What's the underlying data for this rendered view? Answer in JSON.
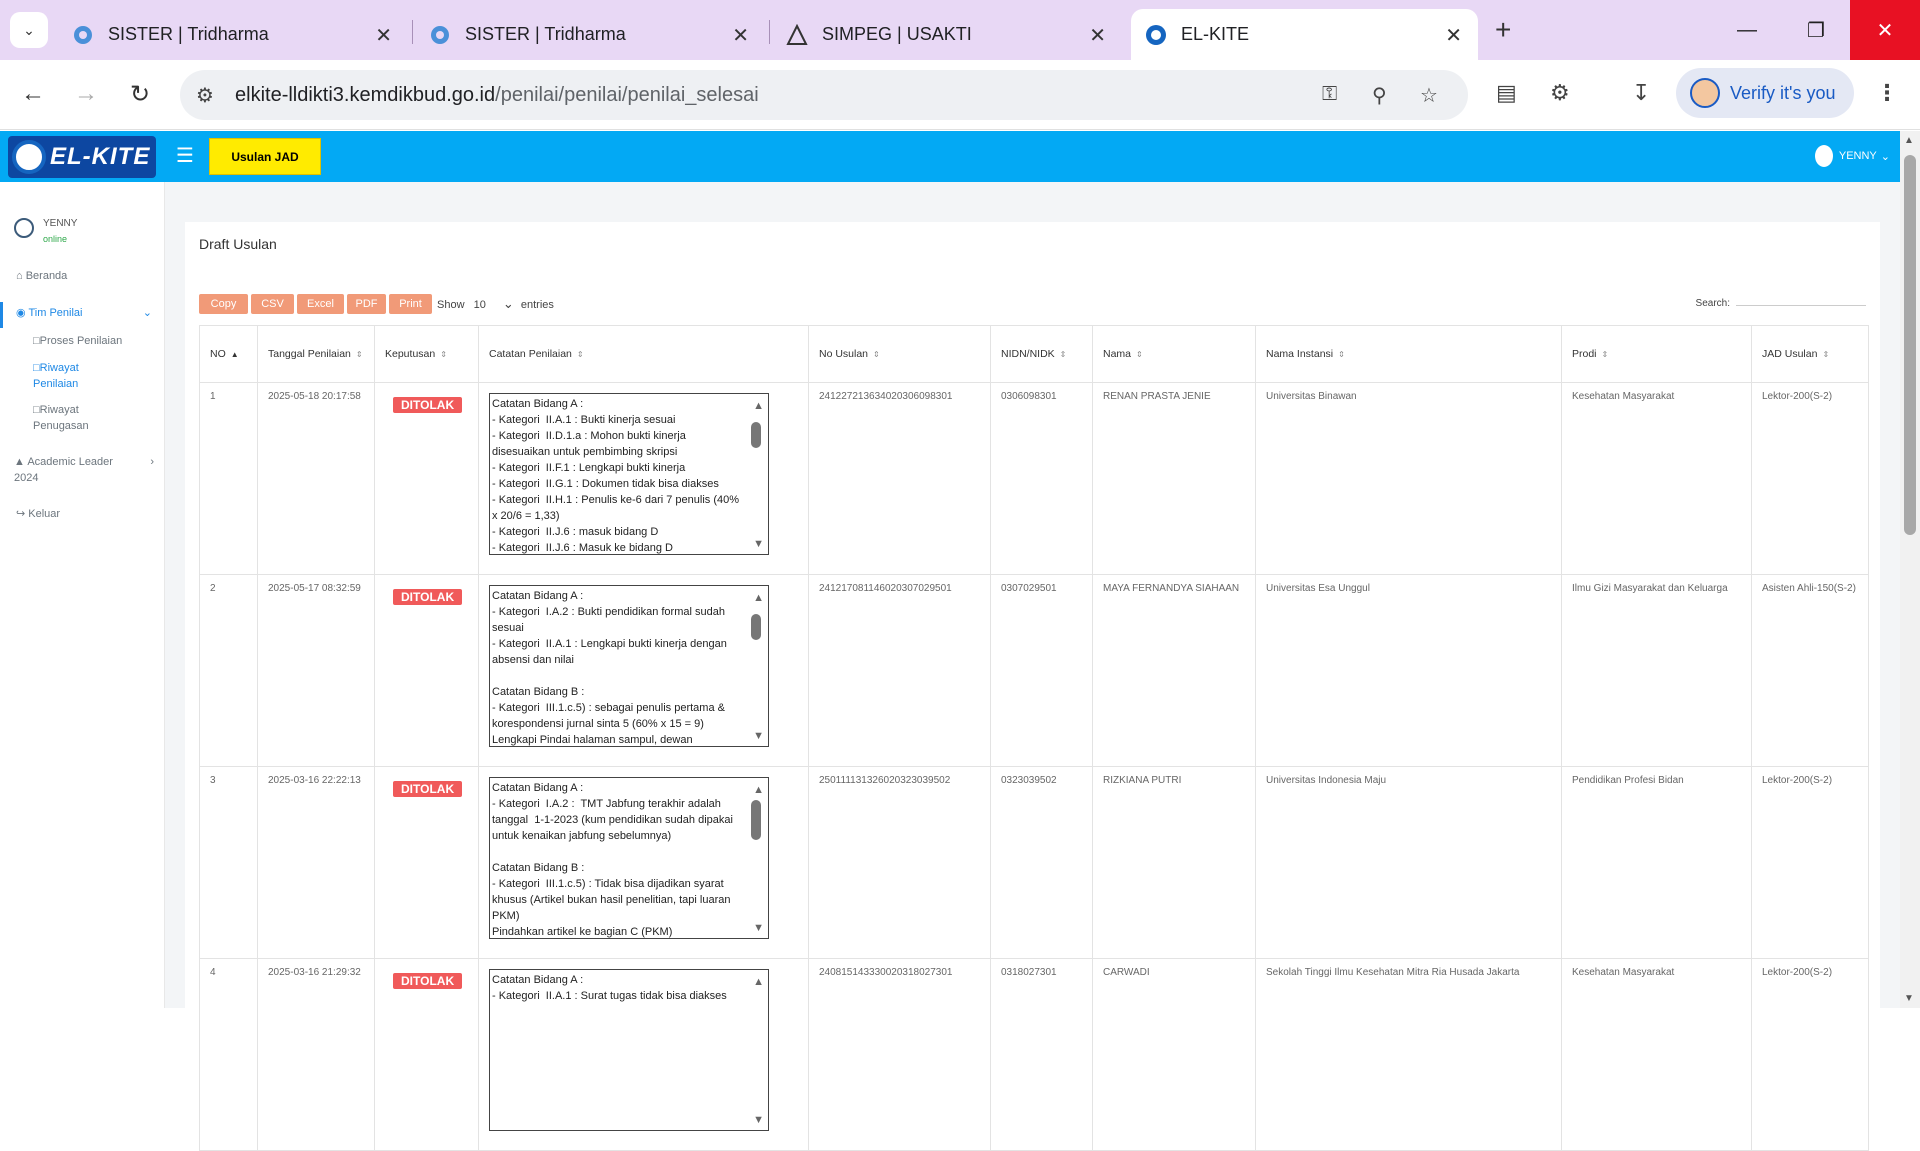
{
  "browser": {
    "tabs": [
      {
        "title": "SISTER | Tridharma",
        "icon": "sister-icon"
      },
      {
        "title": "SISTER | Tridharma",
        "icon": "sister-icon"
      },
      {
        "title": "SIMPEG | USAKTI",
        "icon": "simpeg-icon"
      },
      {
        "title": "EL-KITE",
        "icon": "elkite-icon"
      }
    ],
    "url_host": "elkite-lldikti3.kemdikbud.go.id",
    "url_path": "/penilai/penilai/penilai_selesai",
    "verify_label": "Verify it's you"
  },
  "app": {
    "logo_text": "EL-KITE",
    "usulan_button": "Usulan JAD",
    "header_user": "YENNY"
  },
  "sidebar": {
    "user_name": "YENNY",
    "status": "online",
    "beranda": "Beranda",
    "tim_penilai": "Tim Penilai",
    "proses_penilaian": "Proses Penilaian",
    "riwayat_penilaian_1": "Riwayat",
    "riwayat_penilaian_2": "Penilaian",
    "riwayat_penugasan_1": "Riwayat",
    "riwayat_penugasan_2": "Penugasan",
    "academic_leader_1": "Academic Leader",
    "academic_leader_2": "2024",
    "keluar": "Keluar"
  },
  "main": {
    "title": "Draft Usulan",
    "buttons": [
      "Copy",
      "CSV",
      "Excel",
      "PDF",
      "Print"
    ],
    "show_label": "Show",
    "show_value": "10",
    "entries_label": "entries",
    "search_label": "Search:",
    "columns": [
      "NO",
      "Tanggal Penilaian",
      "Keputusan",
      "Catatan Penilaian",
      "No Usulan",
      "NIDN/NIDK",
      "Nama",
      "Nama Instansi",
      "Prodi",
      "JAD Usulan"
    ],
    "rows": [
      {
        "no": "1",
        "tanggal": "2025-05-18 20:17:58",
        "keputusan": "DITOLAK",
        "catatan": "Catatan Bidang A :\n- Kategori  II.A.1 : Bukti kinerja sesuai\n- Kategori  II.D.1.a : Mohon bukti kinerja disesuaikan untuk pembimbing skripsi\n- Kategori  II.F.1 : Lengkapi bukti kinerja\n- Kategori  II.G.1 : Dokumen tidak bisa diakses\n- Kategori  II.H.1 : Penulis ke-6 dari 7 penulis (40% x 20/6 = 1,33)\n- Kategori  II.J.6 : masuk bidang D\n- Kategori  II.J.6 : Masuk ke bidang D",
        "no_usulan": "24122721363402030609830​1",
        "nidn": "0306098301",
        "nama": "RENAN PRASTA JENIE",
        "instansi": "Universitas Binawan",
        "prodi": "Kesehatan Masyarakat",
        "jad": "Lektor-200(S-2)"
      },
      {
        "no": "2",
        "tanggal": "2025-05-17 08:32:59",
        "keputusan": "DITOLAK",
        "catatan": "Catatan Bidang A :\n- Kategori  I.A.2 : Bukti pendidikan formal sudah sesuai\n- Kategori  II.A.1 : Lengkapi bukti kinerja dengan absensi dan nilai\n\nCatatan Bidang B :\n- Kategori  III.1.c.5) : sebagai penulis pertama & korespondensi jurnal sinta 5 (60% x 15 = 9)\nLengkapi Pindai halaman sampul, dewan",
        "no_usulan": "2412170811460203070295​01",
        "nidn": "0307029501",
        "nama": "MAYA FERNANDYA SIAHAAN",
        "instansi": "Universitas Esa Unggul",
        "prodi": "Ilmu Gizi Masyarakat dan Keluarga",
        "jad": "Asisten Ahli-150(S-2)"
      },
      {
        "no": "3",
        "tanggal": "2025-03-16 22:22:13",
        "keputusan": "DITOLAK",
        "catatan": "Catatan Bidang A :\n- Kategori  I.A.2 :  TMT Jabfung terakhir adalah tanggal  1-1-2023 (kum pendidikan sudah dipakai untuk kenaikan jabfung sebelumnya)\n\nCatatan Bidang B :\n- Kategori  III.1.c.5) : Tidak bisa dijadikan syarat khusus (Artikel bukan hasil penelitian, tapi luaran PKM)\nPindahkan artikel ke bagian C (PKM)",
        "no_usulan": "250111131326020323039502",
        "nidn": "0323039502",
        "nama": "RIZKIANA PUTRI",
        "instansi": "Universitas Indonesia Maju",
        "prodi": "Pendidikan Profesi Bidan",
        "jad": "Lektor-200(S-2)"
      },
      {
        "no": "4",
        "tanggal": "2025-03-16 21:29:32",
        "keputusan": "DITOLAK",
        "catatan": "Catatan Bidang A :\n- Kategori  II.A.1 : Surat tugas tidak bisa diakses",
        "no_usulan": "240815143330020318027301",
        "nidn": "0318027301",
        "nama": "CARWADI",
        "instansi": "Sekolah Tinggi Ilmu Kesehatan Mitra Ria Husada Jakarta",
        "prodi": "Kesehatan Masyarakat",
        "jad": "Lektor-200(S-2)"
      }
    ]
  }
}
